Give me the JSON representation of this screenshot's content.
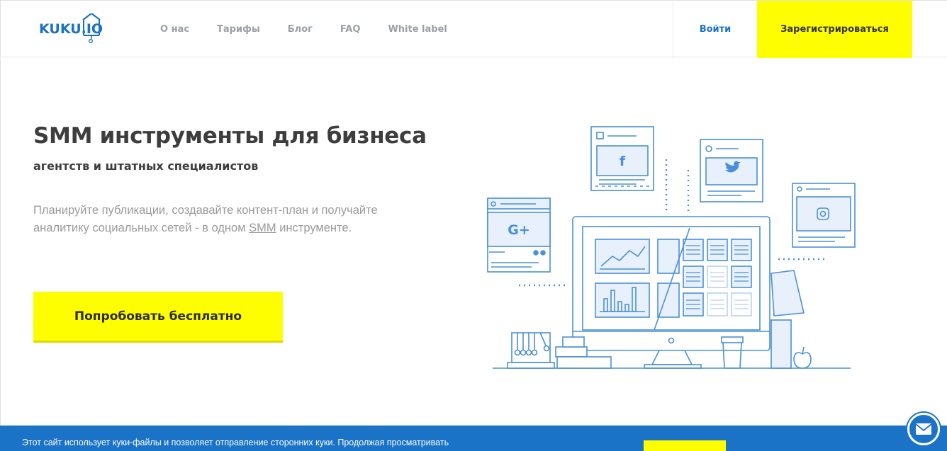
{
  "header": {
    "logo_text": "KUKU.IO",
    "nav": [
      {
        "label": "О нас"
      },
      {
        "label": "Тарифы"
      },
      {
        "label": "Блог"
      },
      {
        "label": "FAQ"
      },
      {
        "label": "White label"
      }
    ],
    "login_label": "Войти",
    "register_label": "Зарегистрироваться"
  },
  "hero": {
    "title": "SMM инструменты для бизнеса",
    "subtitle": "агентств и штатных специалистов",
    "description_before": "Планируйте публикации, создавайте контент-план и получайте аналитику социальных сетей - в одном ",
    "description_link": "SMM",
    "description_after": " инструменте.",
    "cta_label": "Попробовать бесплатно"
  },
  "illustration": {
    "cards": [
      "facebook-icon",
      "twitter-icon",
      "google-plus-icon",
      "instagram-icon"
    ]
  },
  "cookie_bar": {
    "text": "Этот сайт использует куки-файлы и позволяет отправление сторонних куки. Продолжая просматривать"
  },
  "colors": {
    "brand_blue": "#1a73c6",
    "accent_yellow": "#fffe00",
    "illus_blue": "#4a90d9",
    "illus_fill": "#e8f1fb"
  }
}
